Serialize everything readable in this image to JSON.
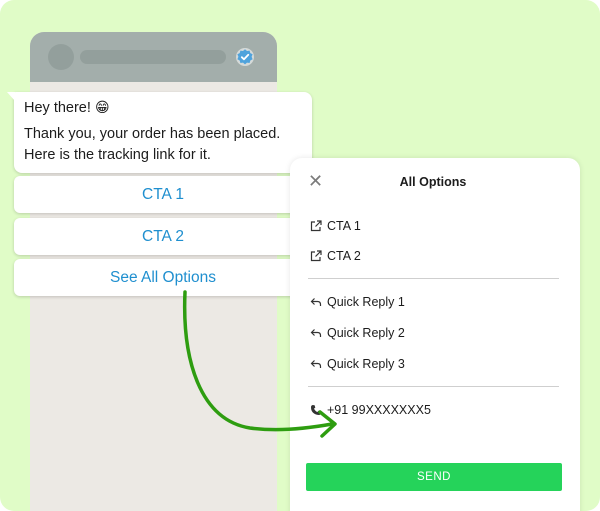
{
  "colors": {
    "background": "#e0fcc7",
    "phone_header": "#a3aeab",
    "link_blue": "#1f8fcf",
    "send_green": "#25d35a",
    "arrow_green": "#2e9d10"
  },
  "phone": {
    "header_icon": "verified-badge-icon"
  },
  "message": {
    "greeting": "Hey there!",
    "emoji": "😁",
    "line1": "Thank you, your order has been placed.",
    "line2": "Here is the tracking link for it."
  },
  "chat_buttons": {
    "cta1": "CTA 1",
    "cta2": "CTA 2",
    "see_all": "See All Options"
  },
  "options_panel": {
    "title": "All Options",
    "close_icon": "close-icon",
    "cta_items": [
      {
        "label": "CTA 1",
        "icon": "external-link-icon"
      },
      {
        "label": "CTA 2",
        "icon": "external-link-icon"
      }
    ],
    "reply_items": [
      {
        "label": "Quick Reply 1",
        "icon": "reply-icon"
      },
      {
        "label": "Quick Reply 2",
        "icon": "reply-icon"
      },
      {
        "label": "Quick Reply 3",
        "icon": "reply-icon"
      }
    ],
    "phone_item": {
      "label": "+91 99XXXXXXX5",
      "icon": "phone-icon"
    },
    "send_label": "SEND"
  }
}
